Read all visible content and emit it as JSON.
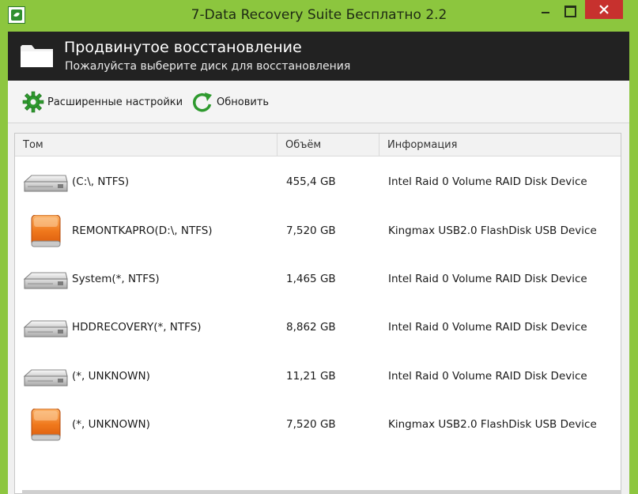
{
  "window": {
    "title": "7-Data Recovery Suite Бесплатно 2.2",
    "accent_color": "#8cc63e",
    "close_color": "#c7312e"
  },
  "header": {
    "title": "Продвинутое восстановление",
    "subtitle": "Пожалуйста выберите диск для восстановления"
  },
  "toolbar": {
    "settings_label": "Расширенные настройки",
    "refresh_label": "Обновить"
  },
  "table": {
    "columns": [
      "Том",
      "Объём",
      "Информация"
    ],
    "rows": [
      {
        "volume": "(C:\\, NTFS)",
        "size": "455,4 GB",
        "info": "Intel  Raid 0 Volume RAID Disk Device",
        "icon": "hdd-icon"
      },
      {
        "volume": "REMONTKAPRO(D:\\, NTFS)",
        "size": "7,520 GB",
        "info": "Kingmax  USB2.0 FlashDisk USB Device",
        "icon": "usb-drive-icon"
      },
      {
        "volume": "System(*, NTFS)",
        "size": "1,465 GB",
        "info": "Intel  Raid 0 Volume RAID Disk Device",
        "icon": "hdd-icon"
      },
      {
        "volume": "HDDRECOVERY(*, NTFS)",
        "size": "8,862 GB",
        "info": "Intel  Raid 0 Volume RAID Disk Device",
        "icon": "hdd-icon"
      },
      {
        "volume": "(*, UNKNOWN)",
        "size": "11,21 GB",
        "info": "Intel  Raid 0 Volume RAID Disk Device",
        "icon": "hdd-icon"
      },
      {
        "volume": "(*, UNKNOWN)",
        "size": "7,520 GB",
        "info": "Kingmax  USB2.0 FlashDisk USB Device",
        "icon": "usb-drive-icon"
      }
    ]
  }
}
